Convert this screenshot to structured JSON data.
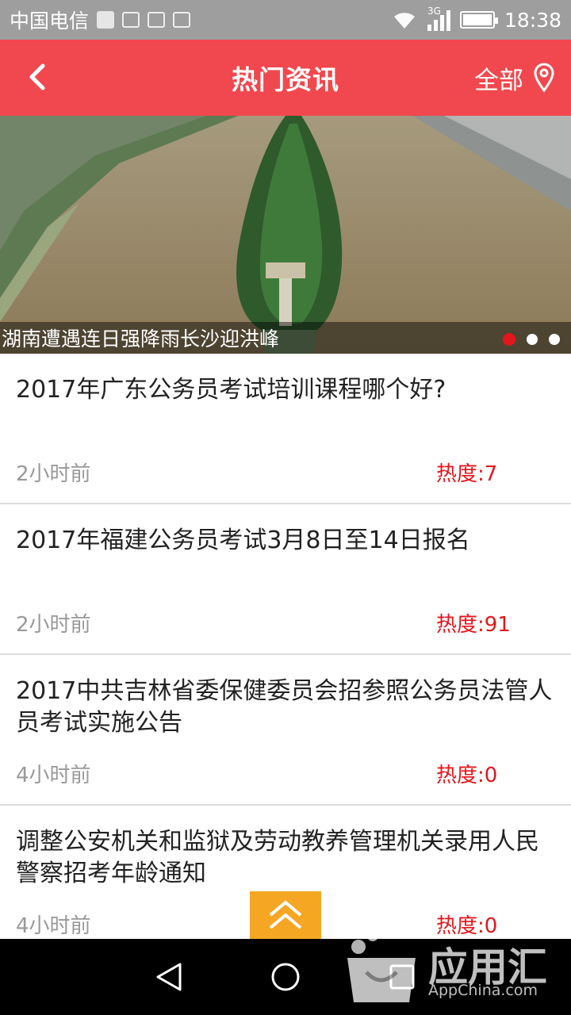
{
  "status_bar": {
    "carrier": "中国电信",
    "network": "3G",
    "time": "18:38"
  },
  "header": {
    "back_icon": "chevron-left-icon",
    "title": "热门资讯",
    "region_label": "全部",
    "location_icon": "location-pin-icon",
    "background_color": "#f0484e"
  },
  "banner": {
    "caption": "湖南遭遇连日强降雨长沙迎洪峰",
    "slide_count": 3,
    "active_slide": 1
  },
  "news": [
    {
      "title": "2017年广东公务员考试培训课程哪个好?",
      "time": "2小时前",
      "heat": "热度:7"
    },
    {
      "title": "2017年福建公务员考试3月8日至14日报名",
      "time": "2小时前",
      "heat": "热度:91"
    },
    {
      "title": "2017中共吉林省委保健委员会招参照公务员法管人员考试实施公告",
      "time": "4小时前",
      "heat": "热度:0"
    },
    {
      "title": "调整公安机关和监狱及劳动教养管理机关录用人民警察招考年龄通知",
      "time": "4小时前",
      "heat": "热度:0"
    }
  ],
  "scroll_top_icon": "double-chevron-up-icon",
  "watermark": {
    "text": "应用汇",
    "sub": "AppChina.com"
  },
  "nav_bar": {
    "back_icon": "triangle-back-icon",
    "home_icon": "circle-home-icon",
    "recents_icon": "square-recents-icon"
  },
  "colors": {
    "accent": "#f0484e",
    "heat": "#e3161c",
    "scroll_top": "#f5a623"
  }
}
